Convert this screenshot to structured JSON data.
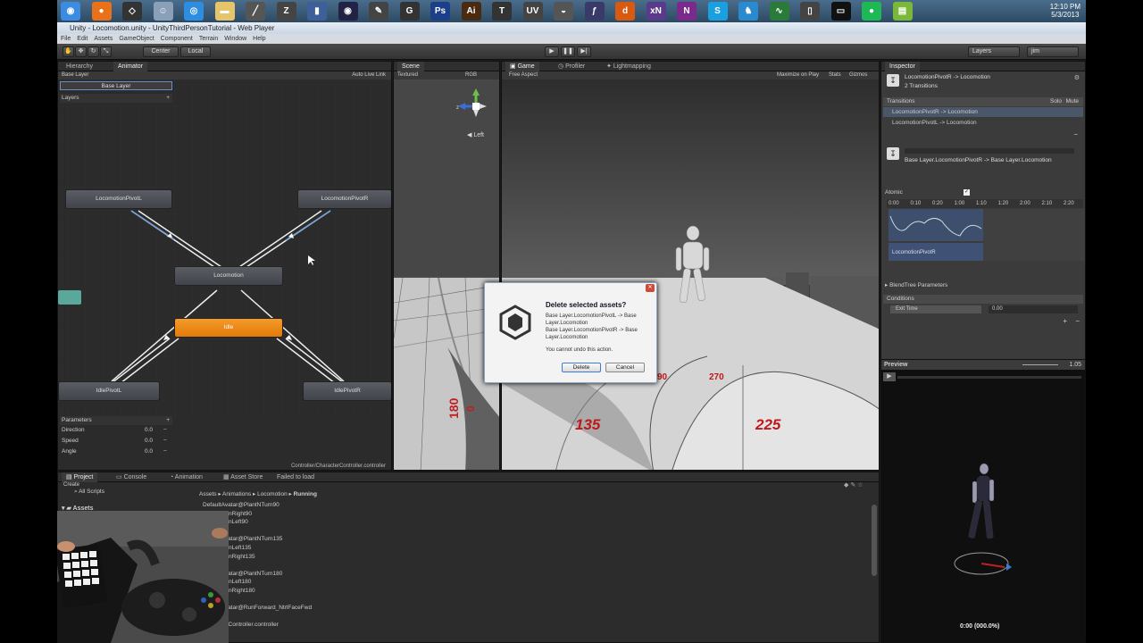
{
  "taskbar": {
    "icons": [
      {
        "name": "chrome-icon",
        "glyph": "◉",
        "color": "#3b8be0"
      },
      {
        "name": "firefox-icon",
        "glyph": "●",
        "color": "#e8711a"
      },
      {
        "name": "unity-icon",
        "glyph": "◇",
        "color": "#333333"
      },
      {
        "name": "finder-icon",
        "glyph": "☺",
        "color": "#8aa0b8"
      },
      {
        "name": "safari-icon",
        "glyph": "◎",
        "color": "#2d8de0"
      },
      {
        "name": "folder-icon",
        "glyph": "▬",
        "color": "#e6c46a"
      },
      {
        "name": "pen-icon",
        "glyph": "╱",
        "color": "#555555"
      },
      {
        "name": "zbrush-icon",
        "glyph": "Z",
        "color": "#444444"
      },
      {
        "name": "book-icon",
        "glyph": "▮",
        "color": "#3d5f9a"
      },
      {
        "name": "obs-icon",
        "glyph": "◉",
        "color": "#222244"
      },
      {
        "name": "pencil-icon",
        "glyph": "✎",
        "color": "#444444"
      },
      {
        "name": "g-icon",
        "glyph": "G",
        "color": "#333333"
      },
      {
        "name": "photoshop-icon",
        "glyph": "Ps",
        "color": "#1c3f8a"
      },
      {
        "name": "illustrator-icon",
        "glyph": "Ai",
        "color": "#4a2a10"
      },
      {
        "name": "topogun-icon",
        "glyph": "T",
        "color": "#333333"
      },
      {
        "name": "uv-icon",
        "glyph": "UV",
        "color": "#444444"
      },
      {
        "name": "mask-icon",
        "glyph": "◒",
        "color": "#555555"
      },
      {
        "name": "brush-icon",
        "glyph": "ƒ",
        "color": "#3a3a6a"
      },
      {
        "name": "substance-icon",
        "glyph": "d",
        "color": "#d85a10"
      },
      {
        "name": "xnormal-icon",
        "glyph": "xN",
        "color": "#5a3a8a"
      },
      {
        "name": "onenote-icon",
        "glyph": "N",
        "color": "#7a2a8a"
      },
      {
        "name": "skype-icon",
        "glyph": "S",
        "color": "#1aa0e0"
      },
      {
        "name": "android-icon",
        "glyph": "♞",
        "color": "#2a8ad0"
      },
      {
        "name": "speed-icon",
        "glyph": "∿",
        "color": "#2a7a3a"
      },
      {
        "name": "usb-icon",
        "glyph": "▯",
        "color": "#444444"
      },
      {
        "name": "terminal-icon",
        "glyph": "▭",
        "color": "#111111"
      },
      {
        "name": "spotify-icon",
        "glyph": "●",
        "color": "#1db954"
      },
      {
        "name": "notepad-icon",
        "glyph": "▤",
        "color": "#7ab83a"
      }
    ],
    "clock_time": "12:10 PM",
    "clock_date": "5/3/2013"
  },
  "window": {
    "title": "Unity - Locomotion.unity - UnityThirdPersonTutorial - Web Player"
  },
  "menu": [
    "File",
    "Edit",
    "Assets",
    "GameObject",
    "Component",
    "Terrain",
    "Window",
    "Help"
  ],
  "toolbar": {
    "pivot": "Center",
    "space": "Local",
    "layers": "Layers",
    "layout": "jim"
  },
  "animator_panel": {
    "tabs": [
      "Hierarchy",
      "Animator"
    ],
    "breadcrumb": "Base Layer",
    "auto_live_link": "Auto Live Link",
    "layer_name": "Base Layer",
    "layers_label": "Layers",
    "nodes": {
      "locomotion_pivot_l": "LocomotionPivotL",
      "locomotion_pivot_r": "LocomotionPivotR",
      "locomotion": "Locomotion",
      "idle": "Idle",
      "idle_pivot_l": "IdlePivotL",
      "idle_pivot_r": "IdlePivotR"
    },
    "parameters_label": "Parameters",
    "parameters": [
      {
        "name": "Direction",
        "value": "0.0"
      },
      {
        "name": "Speed",
        "value": "0.0"
      },
      {
        "name": "Angle",
        "value": "0.0"
      }
    ],
    "controller_path": "Controller/CharacterController.controller"
  },
  "scene_panel": {
    "tab": "Scene",
    "render": "Textured",
    "color": "RGB",
    "view": "Left"
  },
  "game_panel": {
    "tabs": [
      "Game",
      "Profiler",
      "Lightmapping"
    ],
    "aspect": "Free Aspect",
    "maximize": "Maximize on Play",
    "stats": "Stats",
    "gizmos": "Gizmos",
    "floor_numbers": {
      "n135": "135",
      "n225": "225",
      "n180": "180",
      "n90": "90",
      "n270": "270",
      "n0": "0"
    }
  },
  "dialog": {
    "title": "Delete selected assets?",
    "line1": "Base Layer.LocomotionPivotL -> Base",
    "line2": "Layer.Locomotion",
    "line3": "Base Layer.LocomotionPivotR -> Base",
    "line4": "Layer.Locomotion",
    "warning": "You cannot undo this action.",
    "delete": "Delete",
    "cancel": "Cancel"
  },
  "inspector": {
    "tab": "Inspector",
    "header_title": "LocomotionPivotR -> Locomotion",
    "header_sub": "2 Transitions",
    "transitions_label": "Transitions",
    "solo": "Solo",
    "mute": "Mute",
    "transitions": [
      "LocomotionPivotR -> Locomotion",
      "LocomotionPivotL -> Locomotion"
    ],
    "selected_transition": "Base Layer.LocomotionPivotR -> Base Layer.Locomotion",
    "atomic": "Atomic",
    "timeline": [
      "0:00",
      "0:10",
      "0:20",
      "1:00",
      "1:10",
      "1:20",
      "2:00",
      "2:10",
      "2:20"
    ],
    "clip_name": "LocomotionPivotR",
    "blendtree": "BlendTree Parameters",
    "conditions": "Conditions",
    "condition_param": "Exit Time",
    "condition_value": "0.00",
    "preview": "Preview",
    "preview_speed": "1.05",
    "preview_time": "0:00 (000.0%)"
  },
  "project": {
    "tabs": [
      "Project",
      "Console",
      "Animation",
      "Asset Store"
    ],
    "status": "Failed to load",
    "create": "Create",
    "all_scripts": "All Scripts",
    "assets_label": "Assets",
    "path": [
      "Assets",
      "Animations",
      "Locomotion",
      "Running"
    ],
    "files": [
      "DefaultAvatar@PlantNTurn90",
      "PlantNTurnRight90",
      "PlantNTurnLeft90",
      "ference",
      "DefaultAvatar@PlantNTurn135",
      "PlantNTurnLeft135",
      "PlantNTurnRight135",
      "ference",
      "DefaultAvatar@PlantNTurn180",
      "PlantNTurnLeft180",
      "PlantNTurnRight180",
      "ference",
      "DefaultAvatar@RunForward_NtrlFaceFwd",
      "n",
      "CharacterController.controller"
    ]
  }
}
